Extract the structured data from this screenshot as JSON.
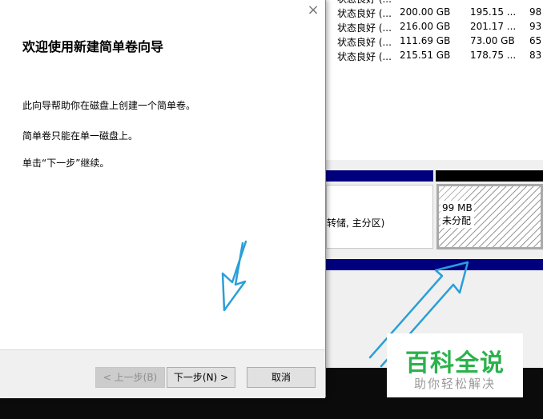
{
  "background": {
    "volumes": [
      {
        "status": "状态良好 (...",
        "capacity": "200.00 GB",
        "free": "195.15 ...",
        "pct": "98"
      },
      {
        "status": "状态良好 (...",
        "capacity": "216.00 GB",
        "free": "201.17 ...",
        "pct": "93"
      },
      {
        "status": "状态良好 (...",
        "capacity": "111.69 GB",
        "free": "73.00 GB",
        "pct": "65"
      },
      {
        "status": "状态良好 (...",
        "capacity": "215.51 GB",
        "free": "178.75 ...",
        "pct": "83"
      }
    ],
    "partition_text": "转储, 主分区)",
    "unallocated": {
      "size": "99 MB",
      "label": "未分配"
    }
  },
  "wizard": {
    "title": "欢迎使用新建简单卷向导",
    "para1": "此向导帮助你在磁盘上创建一个简单卷。",
    "para2": "简单卷只能在单一磁盘上。",
    "para3": "单击“下一步”继续。",
    "back_label": "< 上一步(B)",
    "next_label": "下一步(N) >",
    "cancel_label": "取消",
    "close_glyph": "×"
  },
  "watermark": {
    "main": "百科全说",
    "sub": "助你轻松解决"
  },
  "colors": {
    "arrow": "#2a9fd8",
    "bar_blue": "#00007f",
    "watermark_green": "#2bb24c"
  }
}
